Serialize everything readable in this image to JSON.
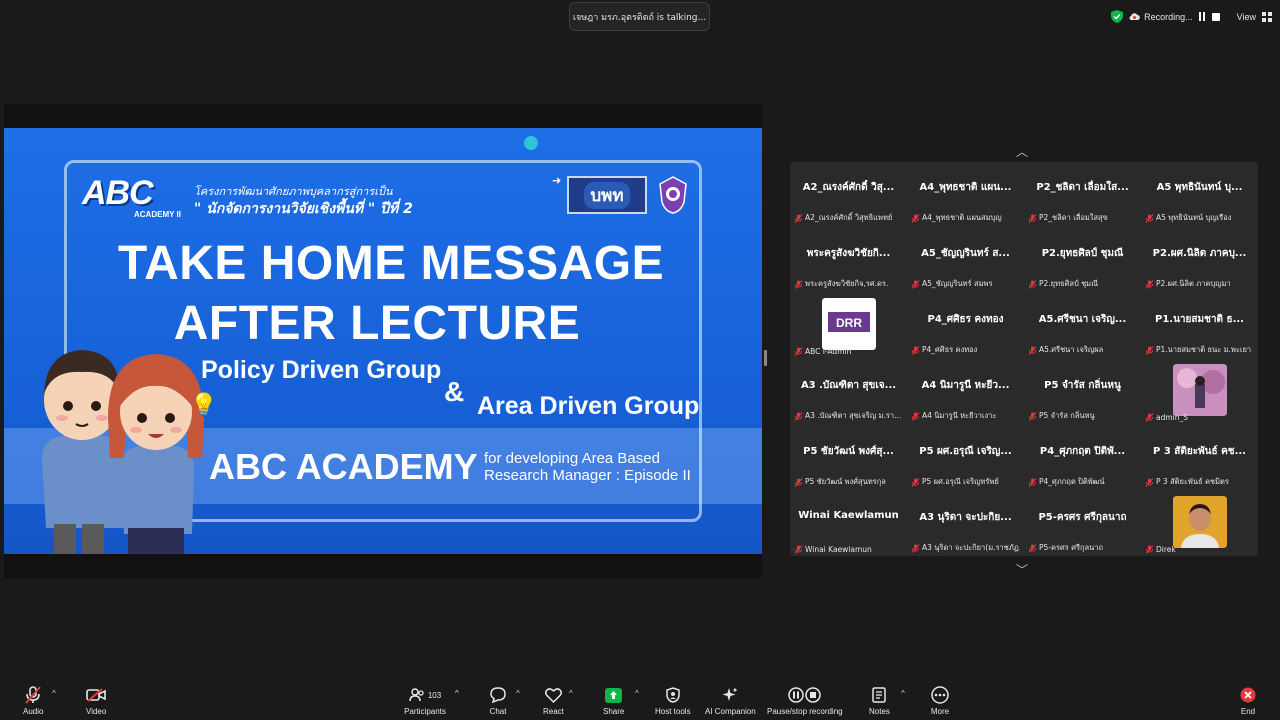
{
  "top": {
    "talking": "เจษฎา มรภ.อุตรดิตถ์ is talking...",
    "recording_label": "Recording...",
    "view_label": "View"
  },
  "slide": {
    "abc_logo": "ABC",
    "abc_sub": "ACADEMY II",
    "project_line1": "โครงการพัฒนาศักยภาพบุคลากรสู่การเป็น",
    "project_line2": "\" นักจัดการงานวิจัยเชิงพื้นที่ \" ปีที่ 2",
    "partner_logo": "บพท",
    "title_line1": "TAKE HOME MESSAGE",
    "title_line2": "AFTER LECTURE",
    "group1": "Policy Driven Group",
    "ampersand": "&",
    "group2": "Area Driven Group",
    "academy": "ABC ACADEMY",
    "for_dev_line1": "for developing Area Based",
    "for_dev_line2": "Research Manager : Episode II"
  },
  "gallery": {
    "tiles": [
      {
        "name": "A2_ณรงค์ศักดิ์ วิสุ...",
        "label": "A2_ณรงค์ศักดิ์ วิสุทธิแพทย์"
      },
      {
        "name": "A4_พุทธชาติ แผน...",
        "label": "A4_พุทธชาติ แผนสมบุญ"
      },
      {
        "name": "P2_ชลิดา เลื่อมใส...",
        "label": "P2_ชลิดา เลื่อมใสสุข"
      },
      {
        "name": "A5 พุทธินันทน์ บุ...",
        "label": "A5 พุทธินันทน์ บุญเรือง"
      },
      {
        "name": "พระครูสังฆวิชัยกิ...",
        "label": "พระครูสังฆวิชัยกิจ,รศ.ดร."
      },
      {
        "name": "A5_ชัญญรินทร์ ส...",
        "label": "A5_ชัญญรินทร์ สมพร"
      },
      {
        "name": "P2.ยุทธศิลป์ ชุมณี",
        "label": "P2.ยุทธศิลป์ ชุมณี"
      },
      {
        "name": "P2.ผศ.นิลิต ภาคบุ...",
        "label": "P2.ผศ.นิลิต ภาคบุญมา"
      },
      {
        "name": "",
        "label": "ABC I-Admin"
      },
      {
        "name": "P4_ศศิธร คงทอง",
        "label": "P4_ศศิธร คงทอง"
      },
      {
        "name": "A5.ศรีชนา เจริญ...",
        "label": "A5.ศรีชนา เจริญผล"
      },
      {
        "name": "P1.นายสมชาติ ธ...",
        "label": "P1.นายสมชาติ ธนะ ม.พะเยา"
      },
      {
        "name": "A3 .บัณฑิตา สุขเจ...",
        "label": "A3 .บัณฑิตา สุขเจริญ ม.รา..."
      },
      {
        "name": "A4 นิมารูนี หะยีว...",
        "label": "A4 นิมารูนี หะยีวาเงาะ"
      },
      {
        "name": "P5 จำรัส กลิ่นหนู",
        "label": "P5 จำรัส กลิ่นหนู"
      },
      {
        "name": "",
        "label": "admin_S"
      },
      {
        "name": "P5 ชัยวัฒน์ พงศ์สุ...",
        "label": "P5 ชัยวัฒน์ พงศ์สุนทรกุล"
      },
      {
        "name": "P5 ผศ.อรุณี เจริญ...",
        "label": "P5 ผศ.อรุณี เจริญทรัพย์"
      },
      {
        "name": "P4_ศุภกฤต ปิติพั...",
        "label": "P4_ศุภกฤต ปิติพัฒน์"
      },
      {
        "name": "P 3 สัติยะพันธ์ คช...",
        "label": "P 3 สัติยะพันธ์ คชมิตร"
      },
      {
        "name": "Winai Kaewlamun",
        "label": "Winai Kaewlamun"
      },
      {
        "name": "A3 นุริดา จะปะกิย...",
        "label": "A3 นุริดา จะปะกิยา(ม.ราชภัฏ..."
      },
      {
        "name": "P5-ครศร ศรีกุลนาถ",
        "label": "P5-ครศร ศรีกุลนาถ"
      },
      {
        "name": "",
        "label": "Direk"
      }
    ]
  },
  "toolbar": {
    "audio": "Audio",
    "video": "Video",
    "participants": "Participants",
    "participants_count": "103",
    "chat": "Chat",
    "react": "React",
    "share": "Share",
    "host_tools": "Host tools",
    "ai_companion": "AI Companion",
    "pause_recording": "Pause/stop recording",
    "notes": "Notes",
    "more": "More",
    "end": "End"
  },
  "colors": {
    "accent_green": "#0eb54a",
    "danger_red": "#e5383b",
    "slide_blue": "#1e6fe6"
  }
}
